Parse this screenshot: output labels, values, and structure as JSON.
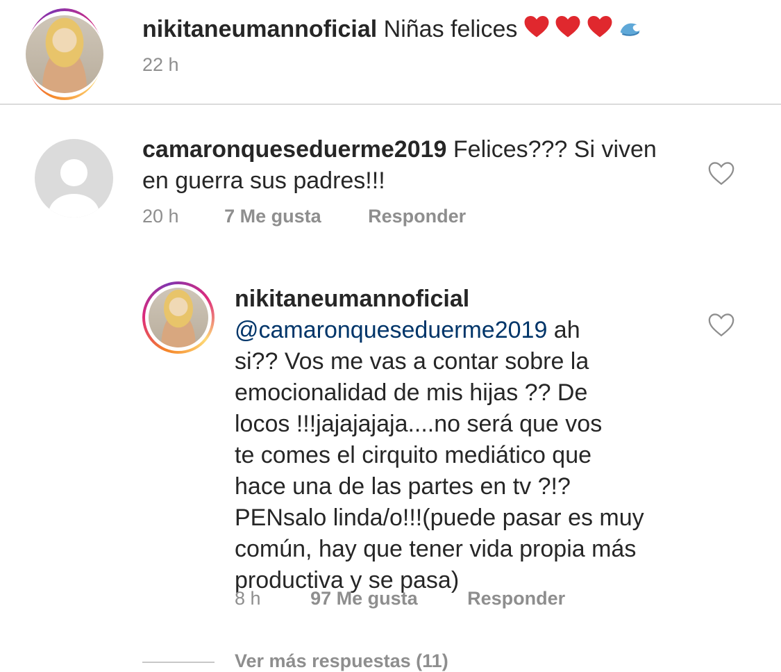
{
  "post": {
    "username": "nikitaneumannoficial",
    "caption": "Niñas felices",
    "emoji_icons": [
      "red-heart-icon",
      "red-heart-icon",
      "red-heart-icon",
      "water-wave-icon"
    ],
    "time": "22 h"
  },
  "comments": [
    {
      "username": "camaronqueseduerme2019",
      "text_line1": "Felices??? Si viven",
      "text_line2": "en guerra sus padres!!!",
      "time": "20 h",
      "likes": "7 Me gusta",
      "reply": "Responder",
      "avatar_icon": "default-profile-icon"
    }
  ],
  "reply": {
    "username": "nikitaneumannoficial",
    "mention": "@camaronqueseduerme2019",
    "lines": [
      " ah",
      "si?? Vos me vas a contar sobre la",
      "emocionalidad  de mis hijas ?? De",
      "locos !!!jajajajaja....no será que vos",
      "te comes el cirquito mediático que",
      "hace una de las partes en tv ?!?",
      "PENsalo linda/o!!!(puede pasar es muy",
      "común,  hay que tener vida propia más",
      "productiva y se pasa)"
    ],
    "time": "8 h",
    "likes": "97 Me gusta",
    "reply_label": "Responder"
  },
  "more_replies": "Ver más respuestas (11)",
  "colors": {
    "text": "#262626",
    "meta": "#8e8e8e",
    "mention": "#003569",
    "heart_outline": "#8e8e8e",
    "emoji_heart": "#e0282e"
  }
}
